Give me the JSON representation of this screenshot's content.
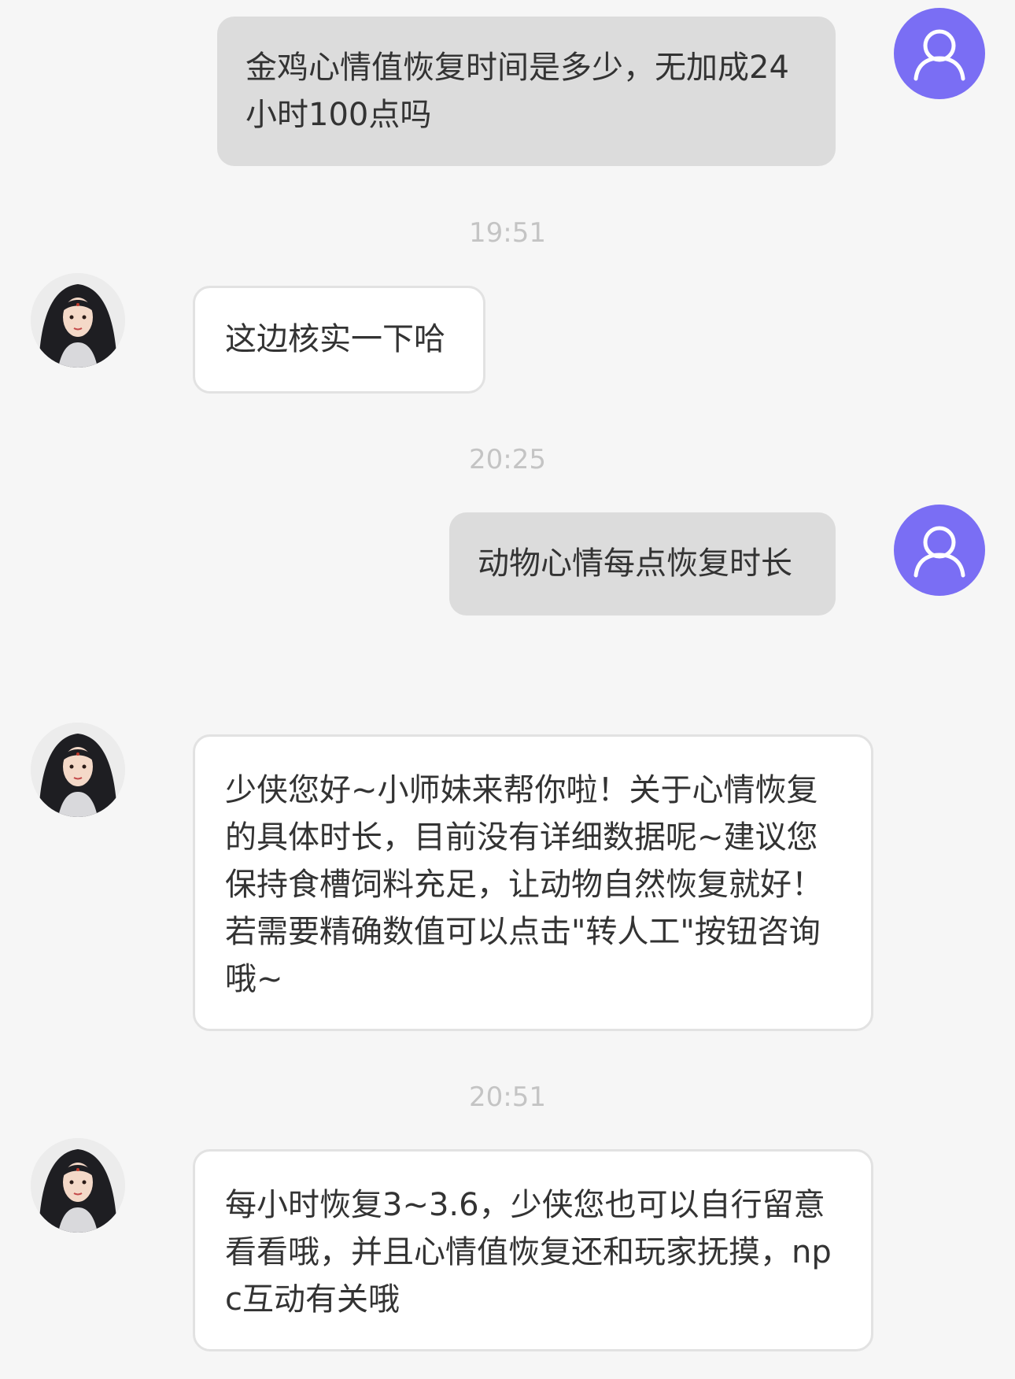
{
  "conversation": {
    "messages": [
      {
        "sender": "user",
        "text": "金鸡心情值恢复时间是多少，无加成24小时100点吗"
      },
      {
        "sender": "agent",
        "text": "这边核实一下哈"
      },
      {
        "sender": "user",
        "text": "动物心情每点恢复时长"
      },
      {
        "sender": "agent",
        "text": "少侠您好~小师妹来帮你啦！关于心情恢复的具体时长，目前没有详细数据呢~建议您保持食槽饲料充足，让动物自然恢复就好！若需要精确数值可以点击\"转人工\"按钮咨询哦~"
      },
      {
        "sender": "agent",
        "text": "每小时恢复3~3.6，少侠您也可以自行留意看看哦，并且心情值恢复还和玩家抚摸，npc互动有关哦"
      }
    ],
    "timestamps": [
      "19:51",
      "20:25",
      "20:51"
    ]
  },
  "icons": {
    "user_avatar": "user-person-icon",
    "agent_avatar": "character-portrait-avatar"
  },
  "colors": {
    "background": "#f6f6f6",
    "user_bubble": "#dcdcdc",
    "agent_bubble": "#ffffff",
    "user_avatar": "#7a6ef4",
    "timestamp": "#c4c4c4",
    "text": "#333333"
  }
}
